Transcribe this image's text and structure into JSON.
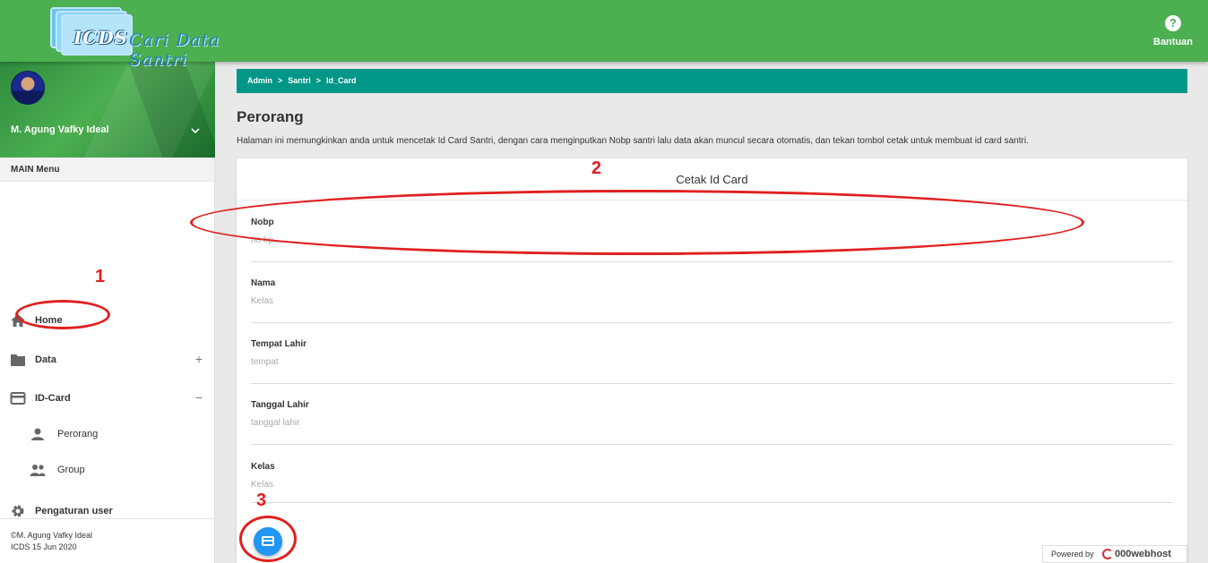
{
  "header": {
    "logo_main": "ICDS",
    "logo_script": "Cari Data Santri",
    "help_label": "Bantuan"
  },
  "sidebar": {
    "user_name": "M. Agung Vafky Ideal",
    "menu_header": "MAIN Menu",
    "items": [
      {
        "label": "Home",
        "icon": "home-icon"
      },
      {
        "label": "Data",
        "icon": "folder-icon",
        "sign": "+"
      },
      {
        "label": "ID-Card",
        "icon": "card-icon",
        "sign": "−"
      },
      {
        "label": "Perorang",
        "icon": "person-icon"
      },
      {
        "label": "Group",
        "icon": "group-icon"
      },
      {
        "label": "Pengaturan user",
        "icon": "gear-icon"
      }
    ],
    "footer_line1": "©M. Agung Vafky Ideal",
    "footer_line2": "ICDS 15 Jun 2020"
  },
  "breadcrumb": [
    "Admin",
    "Santri",
    "Id_Card"
  ],
  "breadcrumb_sep": ">",
  "page": {
    "title": "Perorang",
    "description": "Halaman ini memungkinkan anda untuk mencetak Id Card Santri, dengan cara menginputkan Nobp santri lalu data akan muncul secara otomatis, dan tekan tombol cetak untuk membuat id card santri."
  },
  "card": {
    "title": "Cetak Id Card",
    "fields": [
      {
        "label": "Nobp",
        "placeholder": "no bp...."
      },
      {
        "label": "Nama",
        "placeholder": "Kelas"
      },
      {
        "label": "Tempat Lahir",
        "placeholder": "tempat"
      },
      {
        "label": "Tanggal Lahir",
        "placeholder": "tanggal lahir"
      },
      {
        "label": "Kelas",
        "placeholder": "Kelas"
      }
    ]
  },
  "annotations": {
    "one": "1",
    "two": "2",
    "three": "3",
    "color": "#e02020"
  },
  "powered": {
    "prefix": "Powered by",
    "brand": "000webhost"
  },
  "colors": {
    "topbar": "#4caf50",
    "breadcrumb": "#009688",
    "fab": "#2196f3"
  }
}
